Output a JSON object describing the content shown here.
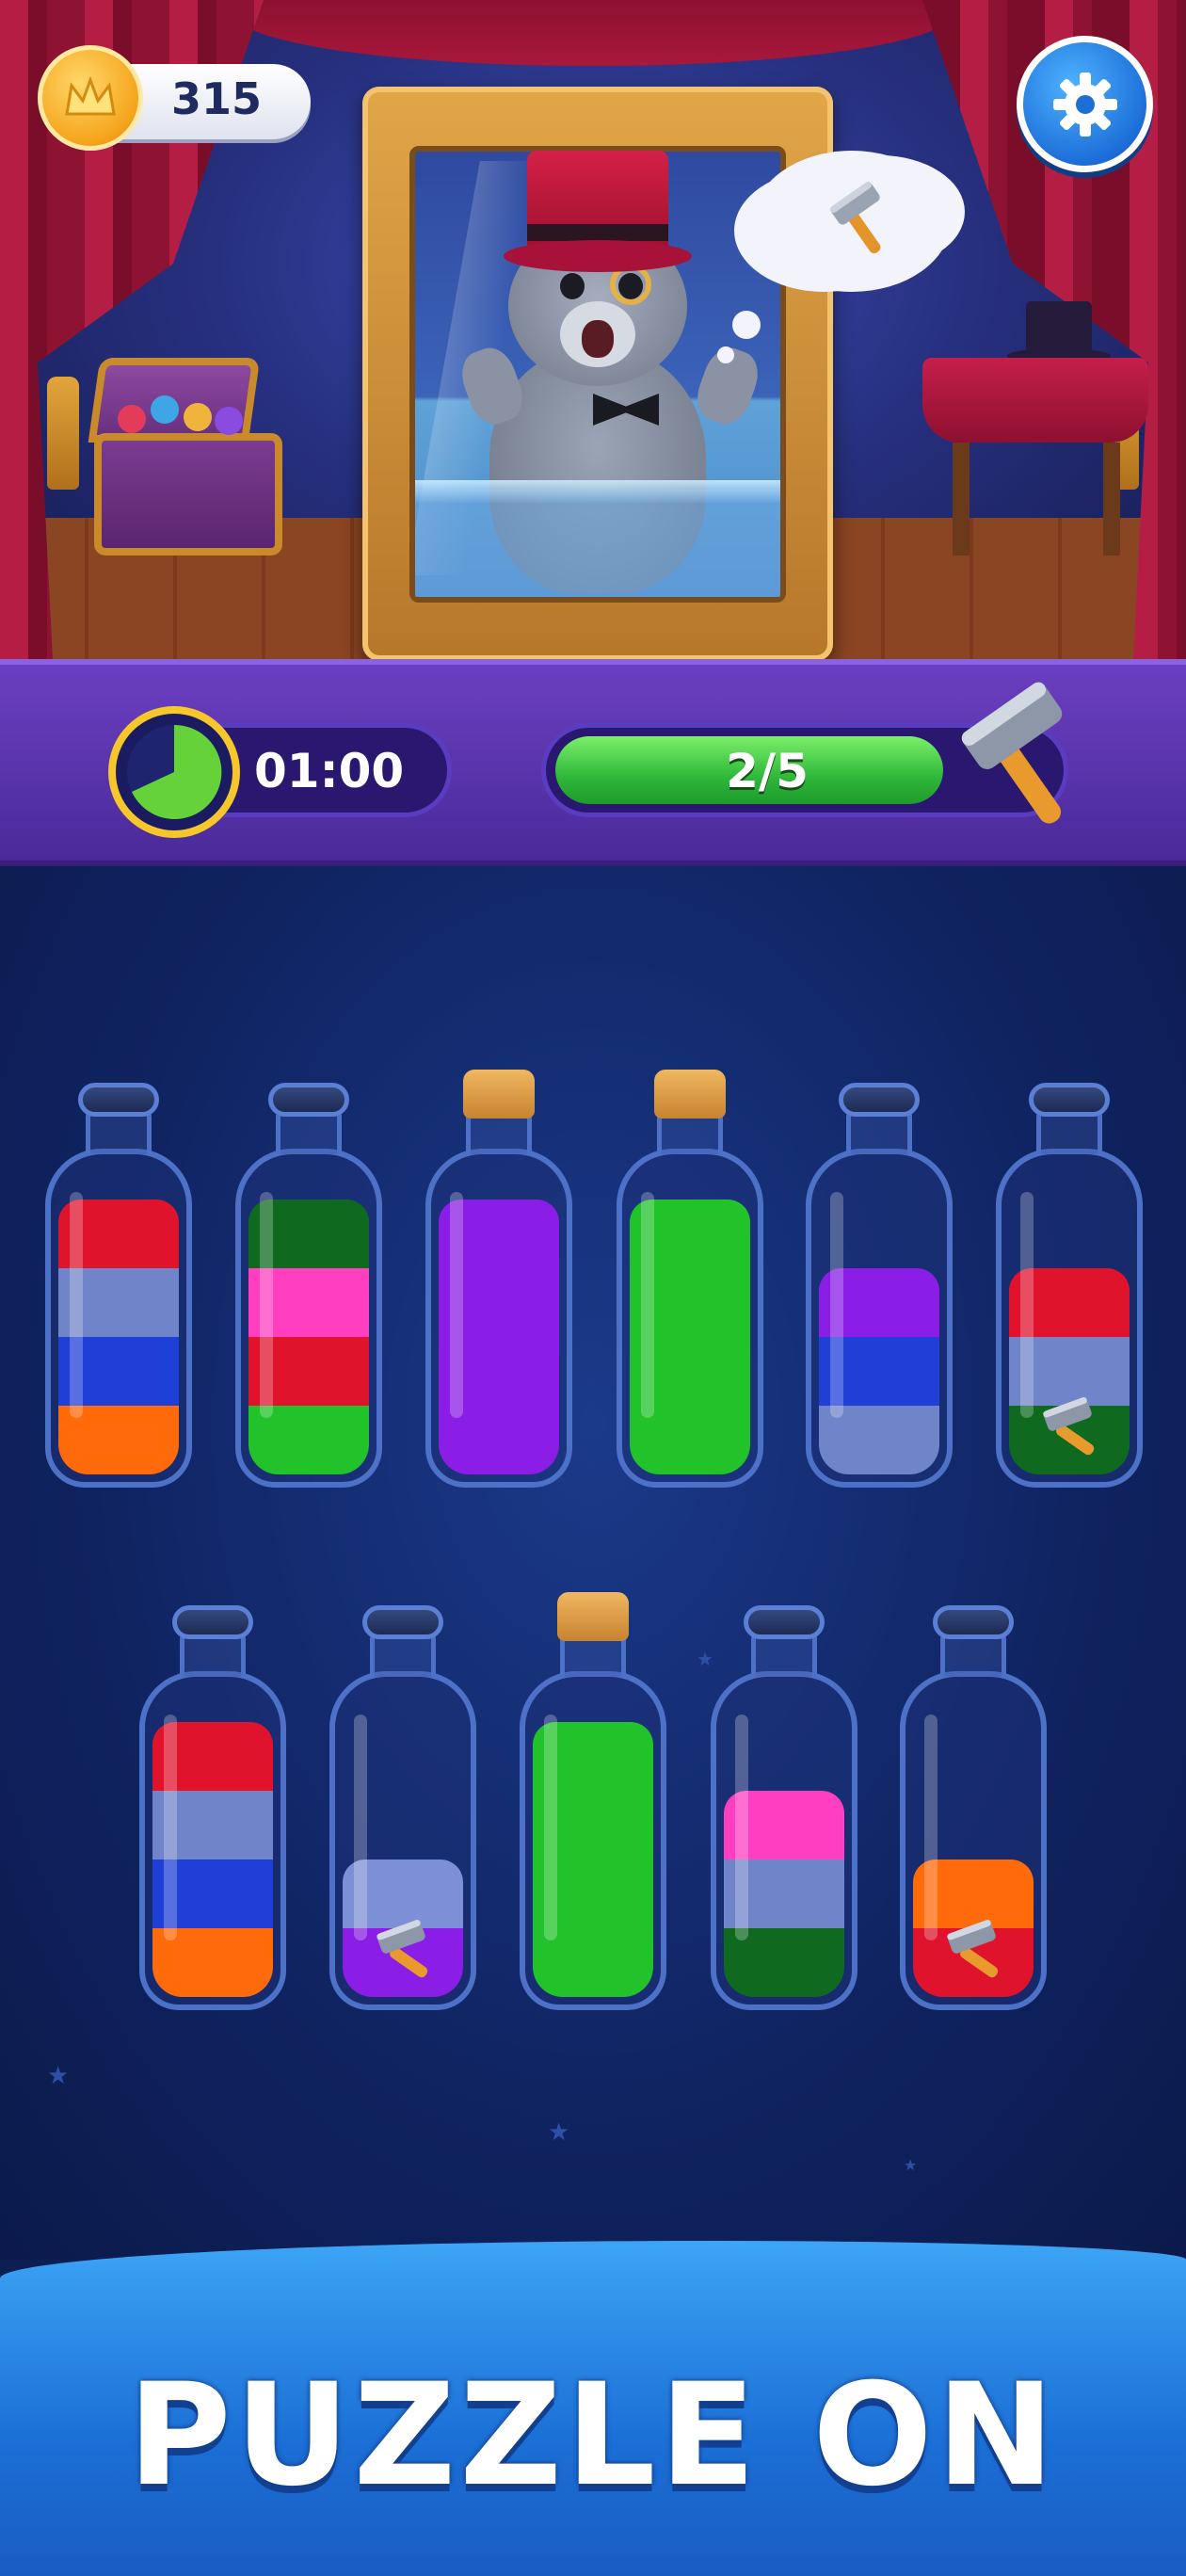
{
  "hud": {
    "coins": "315",
    "settings_icon": "gear-icon"
  },
  "status": {
    "timer": "01:00",
    "progress_text": "2/5",
    "progress_value": 0.4,
    "reward_icon": "hammer-icon"
  },
  "colors": {
    "red": "#e0132c",
    "grayblue": "#6f84c9",
    "blue": "#1f3fd6",
    "orange": "#ff6a0a",
    "darkgreen": "#0f6a20",
    "pink": "#ff3fbf",
    "green": "#22c22a",
    "purple": "#8a1ee6",
    "lavender": "#7d8fd6"
  },
  "bottles": {
    "row1": [
      {
        "layers": [
          "orange",
          "blue",
          "grayblue",
          "red"
        ],
        "corked": false,
        "hammer": false
      },
      {
        "layers": [
          "green",
          "red",
          "pink",
          "darkgreen"
        ],
        "corked": false,
        "hammer": false
      },
      {
        "layers": [
          "purple",
          "purple",
          "purple",
          "purple"
        ],
        "corked": true,
        "hammer": false
      },
      {
        "layers": [
          "green",
          "green",
          "green",
          "green"
        ],
        "corked": true,
        "hammer": false
      },
      {
        "layers": [
          "grayblue",
          "blue",
          "purple"
        ],
        "corked": false,
        "hammer": false
      },
      {
        "layers": [
          "darkgreen",
          "grayblue",
          "red"
        ],
        "corked": false,
        "hammer": true
      }
    ],
    "row2": [
      {
        "layers": [
          "orange",
          "blue",
          "grayblue",
          "red"
        ],
        "corked": false,
        "hammer": false
      },
      {
        "layers": [
          "purple",
          "lavender"
        ],
        "corked": false,
        "hammer": true
      },
      {
        "layers": [
          "green",
          "green",
          "green",
          "green"
        ],
        "corked": true,
        "hammer": false
      },
      {
        "layers": [
          "darkgreen",
          "grayblue",
          "pink"
        ],
        "corked": false,
        "hammer": false
      },
      {
        "layers": [
          "red",
          "orange"
        ],
        "corked": false,
        "hammer": true
      }
    ]
  },
  "banner": {
    "text": "PUZZLE ON"
  }
}
